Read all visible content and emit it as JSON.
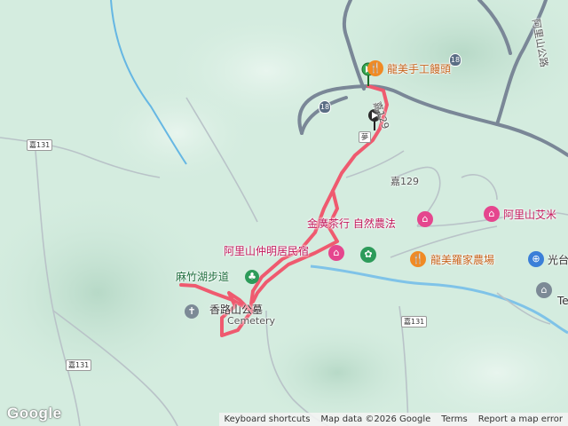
{
  "map": {
    "labels": {
      "mantou": "龍美手工饅頭",
      "route129_top": "嘉129",
      "route129_mid": "嘉129",
      "route131_left": "嘉131",
      "route131_bottom": "嘉131",
      "route131_right": "嘉131",
      "route18_a": "18",
      "route18_b": "18",
      "vertical_road": "阿里山公路",
      "store_shield": "夢",
      "tea_farm": "阿里山艾米",
      "guang_farm": "金廣茶行 自然農法",
      "minju": "阿里山仲明居民宿",
      "trail": "麻竹湖步道",
      "cemetery_road": "香路山公墓",
      "cemetery": "Cemetery",
      "longmei_farm": "龍美羅家農場",
      "guang_right": "光台",
      "te_right": "Te"
    },
    "colors": {
      "route": "#ef5a6f",
      "terrain": "#d4ecdf",
      "highway": "#7a8797"
    }
  },
  "footer": {
    "keyboard": "Keyboard shortcuts",
    "mapdata": "Map data ©2026 Google",
    "terms": "Terms",
    "report": "Report a map error"
  },
  "brand": {
    "logo": "Google"
  }
}
